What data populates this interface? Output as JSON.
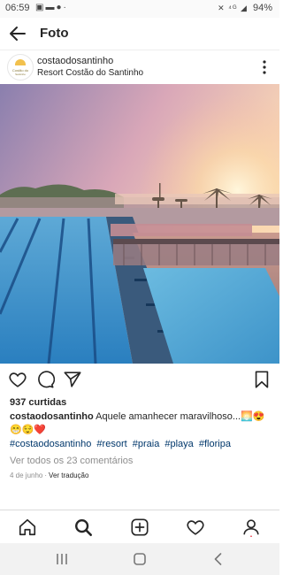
{
  "status_bar": {
    "time": "06:59",
    "left_icons": [
      "image-icon",
      "folder-icon",
      "spotify-icon",
      "dot"
    ],
    "system_text": "⁴ᴳ",
    "battery": "94%"
  },
  "header": {
    "title": "Foto",
    "back_icon": "arrow-left-icon"
  },
  "post": {
    "username": "costaodosantinho",
    "location": "Resort Costão do Santinho",
    "avatar_text": "Costão do Santinho",
    "likes": "937 curtidas",
    "caption_user": "costaodosantinho",
    "caption_text": " Aquele amanhecer maravilhoso...🌅😍😁😌❤️",
    "hashtags": [
      "#costaodosantinho",
      "#resort",
      "#praia",
      "#playa",
      "#floripa"
    ],
    "view_comments": "Ver todos os 23 comentários",
    "date": "4 de junho",
    "separator": "·",
    "translate": "Ver tradução"
  },
  "actions": [
    "heart-icon",
    "comment-icon",
    "share-icon",
    "bookmark-icon"
  ],
  "bottom_nav": [
    "home-icon",
    "search-icon",
    "add-post-icon",
    "activity-heart-icon",
    "profile-icon"
  ],
  "android_nav": [
    "recents-icon",
    "home-button-icon",
    "back-icon"
  ],
  "colors": {
    "accent_link": "#00376b",
    "muted": "#8e8e8e",
    "notification_dot": "#ed4956"
  }
}
